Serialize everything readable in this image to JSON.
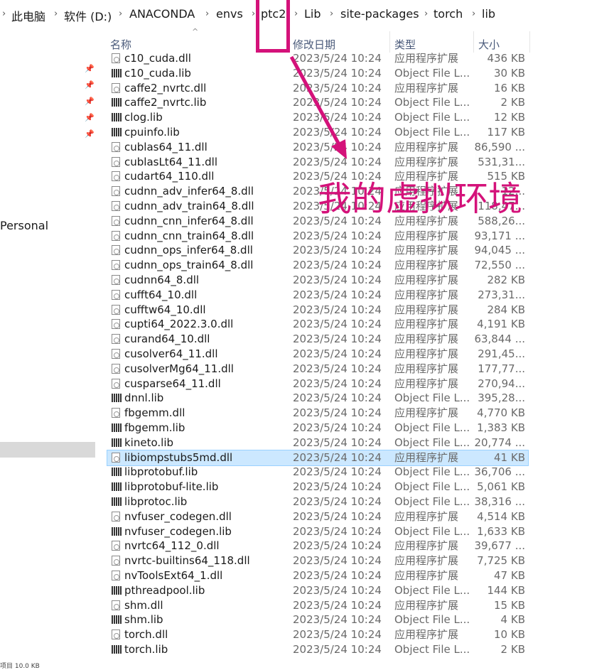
{
  "breadcrumb": [
    "此电脑",
    "软件 (D:)",
    "ANACONDA",
    "envs",
    "ptc2",
    "Lib",
    "site-packages",
    "torch",
    "lib"
  ],
  "nav": {
    "label": "Personal",
    "status_text": "项目 10.0 KB"
  },
  "columns": {
    "name": "名称",
    "date": "修改日期",
    "type": "类型",
    "size": "大小"
  },
  "annotation": {
    "text": "我的虚拟环境",
    "color": "#d4127a"
  },
  "files": [
    {
      "name": "c10_cuda.dll",
      "date": "2023/5/24 10:24",
      "type": "应用程序扩展",
      "size": "436 KB",
      "icon": "dll-icon"
    },
    {
      "name": "c10_cuda.lib",
      "date": "2023/5/24 10:24",
      "type": "Object File L...",
      "size": "30 KB",
      "icon": "lib-icon"
    },
    {
      "name": "caffe2_nvrtc.dll",
      "date": "2023/5/24 10:24",
      "type": "应用程序扩展",
      "size": "16 KB",
      "icon": "dll-icon"
    },
    {
      "name": "caffe2_nvrtc.lib",
      "date": "2023/5/24 10:24",
      "type": "Object File L...",
      "size": "2 KB",
      "icon": "lib-icon"
    },
    {
      "name": "clog.lib",
      "date": "2023/5/24 10:24",
      "type": "Object File L...",
      "size": "12 KB",
      "icon": "lib-icon"
    },
    {
      "name": "cpuinfo.lib",
      "date": "2023/5/24 10:24",
      "type": "Object File L...",
      "size": "117 KB",
      "icon": "lib-icon"
    },
    {
      "name": "cublas64_11.dll",
      "date": "2023/5/24 10:24",
      "type": "应用程序扩展",
      "size": "86,590 ...",
      "icon": "dll-icon"
    },
    {
      "name": "cublasLt64_11.dll",
      "date": "2023/5/24 10:24",
      "type": "应用程序扩展",
      "size": "531,31...",
      "icon": "dll-icon"
    },
    {
      "name": "cudart64_110.dll",
      "date": "2023/5/24 10:24",
      "type": "应用程序扩展",
      "size": "515 KB",
      "icon": "dll-icon"
    },
    {
      "name": "cudnn_adv_infer64_8.dll",
      "date": "2023/5/24 10:24",
      "type": "应用程序扩展",
      "size": "12...",
      "icon": "dll-icon"
    },
    {
      "name": "cudnn_adv_train64_8.dll",
      "date": "2023/5/24 10:24",
      "type": "应用程序扩展",
      "size": "118,47...",
      "icon": "dll-icon"
    },
    {
      "name": "cudnn_cnn_infer64_8.dll",
      "date": "2023/5/24 10:24",
      "type": "应用程序扩展",
      "size": "588,26...",
      "icon": "dll-icon"
    },
    {
      "name": "cudnn_cnn_train64_8.dll",
      "date": "2023/5/24 10:24",
      "type": "应用程序扩展",
      "size": "93,171 ...",
      "icon": "dll-icon"
    },
    {
      "name": "cudnn_ops_infer64_8.dll",
      "date": "2023/5/24 10:24",
      "type": "应用程序扩展",
      "size": "94,045 ...",
      "icon": "dll-icon"
    },
    {
      "name": "cudnn_ops_train64_8.dll",
      "date": "2023/5/24 10:24",
      "type": "应用程序扩展",
      "size": "72,550 ...",
      "icon": "dll-icon"
    },
    {
      "name": "cudnn64_8.dll",
      "date": "2023/5/24 10:24",
      "type": "应用程序扩展",
      "size": "282 KB",
      "icon": "dll-icon"
    },
    {
      "name": "cufft64_10.dll",
      "date": "2023/5/24 10:24",
      "type": "应用程序扩展",
      "size": "273,31...",
      "icon": "dll-icon"
    },
    {
      "name": "cufftw64_10.dll",
      "date": "2023/5/24 10:24",
      "type": "应用程序扩展",
      "size": "284 KB",
      "icon": "dll-icon"
    },
    {
      "name": "cupti64_2022.3.0.dll",
      "date": "2023/5/24 10:24",
      "type": "应用程序扩展",
      "size": "4,191 KB",
      "icon": "dll-icon"
    },
    {
      "name": "curand64_10.dll",
      "date": "2023/5/24 10:24",
      "type": "应用程序扩展",
      "size": "63,844 ...",
      "icon": "dll-icon"
    },
    {
      "name": "cusolver64_11.dll",
      "date": "2023/5/24 10:24",
      "type": "应用程序扩展",
      "size": "291,45...",
      "icon": "dll-icon"
    },
    {
      "name": "cusolverMg64_11.dll",
      "date": "2023/5/24 10:24",
      "type": "应用程序扩展",
      "size": "177,77...",
      "icon": "dll-icon"
    },
    {
      "name": "cusparse64_11.dll",
      "date": "2023/5/24 10:24",
      "type": "应用程序扩展",
      "size": "270,94...",
      "icon": "dll-icon"
    },
    {
      "name": "dnnl.lib",
      "date": "2023/5/24 10:24",
      "type": "Object File L...",
      "size": "395,28...",
      "icon": "lib-icon"
    },
    {
      "name": "fbgemm.dll",
      "date": "2023/5/24 10:24",
      "type": "应用程序扩展",
      "size": "4,770 KB",
      "icon": "dll-icon"
    },
    {
      "name": "fbgemm.lib",
      "date": "2023/5/24 10:24",
      "type": "Object File L...",
      "size": "1,383 KB",
      "icon": "lib-icon"
    },
    {
      "name": "kineto.lib",
      "date": "2023/5/24 10:24",
      "type": "Object File L...",
      "size": "20,774 ...",
      "icon": "lib-icon"
    },
    {
      "name": "libiompstubs5md.dll",
      "date": "2023/5/24 10:24",
      "type": "应用程序扩展",
      "size": "41 KB",
      "icon": "dll-icon",
      "selected": true
    },
    {
      "name": "libprotobuf.lib",
      "date": "2023/5/24 10:24",
      "type": "Object File L...",
      "size": "36,706 ...",
      "icon": "lib-icon"
    },
    {
      "name": "libprotobuf-lite.lib",
      "date": "2023/5/24 10:24",
      "type": "Object File L...",
      "size": "5,061 KB",
      "icon": "lib-icon"
    },
    {
      "name": "libprotoc.lib",
      "date": "2023/5/24 10:24",
      "type": "Object File L...",
      "size": "38,316 ...",
      "icon": "lib-icon"
    },
    {
      "name": "nvfuser_codegen.dll",
      "date": "2023/5/24 10:24",
      "type": "应用程序扩展",
      "size": "4,514 KB",
      "icon": "dll-icon"
    },
    {
      "name": "nvfuser_codegen.lib",
      "date": "2023/5/24 10:24",
      "type": "Object File L...",
      "size": "1,633 KB",
      "icon": "lib-icon"
    },
    {
      "name": "nvrtc64_112_0.dll",
      "date": "2023/5/24 10:24",
      "type": "应用程序扩展",
      "size": "39,677 ...",
      "icon": "dll-icon"
    },
    {
      "name": "nvrtc-builtins64_118.dll",
      "date": "2023/5/24 10:24",
      "type": "应用程序扩展",
      "size": "7,725 KB",
      "icon": "dll-icon"
    },
    {
      "name": "nvToolsExt64_1.dll",
      "date": "2023/5/24 10:24",
      "type": "应用程序扩展",
      "size": "47 KB",
      "icon": "dll-icon"
    },
    {
      "name": "pthreadpool.lib",
      "date": "2023/5/24 10:24",
      "type": "Object File L...",
      "size": "144 KB",
      "icon": "lib-icon"
    },
    {
      "name": "shm.dll",
      "date": "2023/5/24 10:24",
      "type": "应用程序扩展",
      "size": "15 KB",
      "icon": "dll-icon"
    },
    {
      "name": "shm.lib",
      "date": "2023/5/24 10:24",
      "type": "Object File L...",
      "size": "4 KB",
      "icon": "lib-icon"
    },
    {
      "name": "torch.dll",
      "date": "2023/5/24 10:24",
      "type": "应用程序扩展",
      "size": "10 KB",
      "icon": "dll-icon"
    },
    {
      "name": "torch.lib",
      "date": "2023/5/24 10:24",
      "type": "Object File L...",
      "size": "2 KB",
      "icon": "lib-icon"
    }
  ]
}
